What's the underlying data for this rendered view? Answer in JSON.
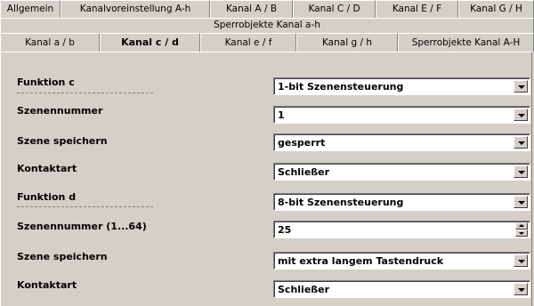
{
  "tabs_row1": [
    "Allgemein",
    "Kanalvoreinstellung A-h",
    "Kanal A / B",
    "Kanal C / D",
    "Kanal E / F",
    "Kanal G / H"
  ],
  "tabs_row2": [
    "Sperrobjekte Kanal a-h"
  ],
  "tabs_row3": [
    "Kanal a / b",
    "Kanal c / d",
    "Kanal e / f",
    "Kanal g / h",
    "Sperrobjekte Kanal A-H"
  ],
  "active_tab": "Kanal c / d",
  "params": {
    "funktion_c": {
      "label": "Funktion c",
      "value": "1-bit Szenensteuerung"
    },
    "szenennummer_c": {
      "label": "Szenennummer",
      "value": "1"
    },
    "szene_speichern_c": {
      "label": "Szene speichern",
      "value": "gesperrt"
    },
    "kontaktart_c": {
      "label": "Kontaktart",
      "value": "Schließer"
    },
    "funktion_d": {
      "label": "Funktion d",
      "value": "8-bit Szenensteuerung"
    },
    "szenennummer_d": {
      "label": "Szenennummer (1...64)",
      "value": "25"
    },
    "szene_speichern_d": {
      "label": "Szene speichern",
      "value": "mit extra langem Tastendruck"
    },
    "kontaktart_d": {
      "label": "Kontaktart",
      "value": "Schließer"
    }
  },
  "icons": {
    "dropdown": "chevron-down-icon",
    "spin_up": "spin-up-icon",
    "spin_down": "spin-down-icon"
  }
}
